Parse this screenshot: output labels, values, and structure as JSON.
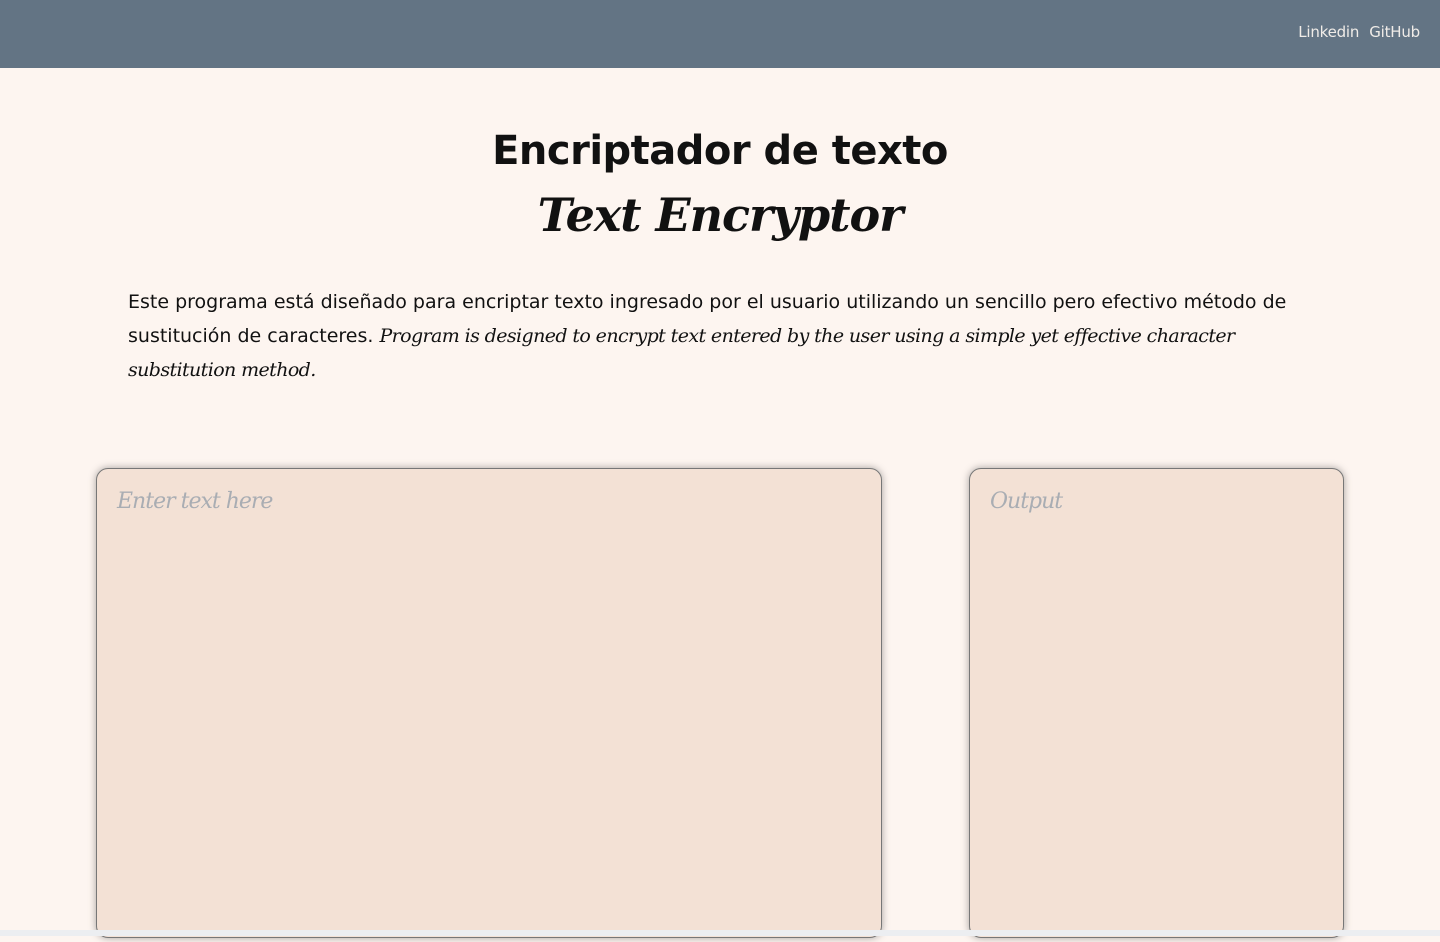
{
  "nav": {
    "links": [
      "Linkedin",
      "GitHub"
    ]
  },
  "header": {
    "title_es": "Encriptador de texto",
    "title_en": "Text Encryptor"
  },
  "description": {
    "es": "Este programa está diseñado para encriptar texto ingresado por el usuario utilizando un sencillo pero efectivo método de sustitución de caracteres.",
    "en": "Program is designed to encrypt text entered by the user using a simple yet effective character substitution method."
  },
  "input": {
    "placeholder": "Enter text here",
    "value": ""
  },
  "output": {
    "placeholder": "Output",
    "value": ""
  },
  "colors": {
    "topbar": "#637484",
    "background": "#fdf5f0",
    "panel": "#f3e1d5"
  }
}
